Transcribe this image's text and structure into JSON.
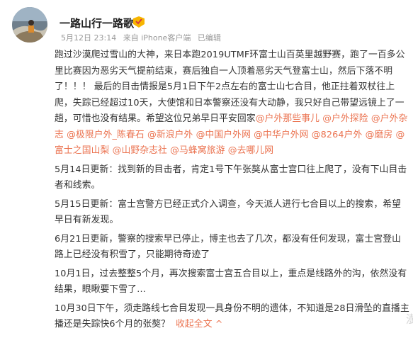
{
  "user": {
    "name": "一路山行一路歌",
    "meta": {
      "date": "5月12日 23:14",
      "source": "来自 iPhone客户端",
      "edited": "已编辑"
    }
  },
  "post": {
    "intro": "跑过沙漠爬过雪山的大神，来日本跑2019UTMF环富士山百英里越野赛，跑了一百多公里比赛因为恶劣天气提前结束，赛后独自一人顶着恶劣天气登富士山，然后下落不明了！！！ 最后的目击情报是5月1日下午2点左右的富士山七合目，他正拄着双杖往上爬，失踪已经超过10天，大使馆和日本警察还没有大动静，我只好自己带望远镜上了一趟，可惜也没有结果。希望这位兄弟早日平安回家",
    "mentions": [
      "@户外那些事儿",
      "@户外探险",
      "@户外杂志",
      "@极限户外_陈春石",
      "@新浪户外",
      "@中国户外网",
      "@中华户外网",
      "@8264户外",
      "@磨房",
      "@富士之国山梨",
      "@山野杂志社",
      "@马蜂窝旅游",
      "@去哪儿网"
    ],
    "updates": [
      "5月14日更新：找到新的目击者，肯定1号下午张獒从富士宫口往上爬了，没有下山目击者和线索。",
      "5月15日更新：富士宫警方已经正式介入调查，今天派人进行七合目以上的搜索，希望早日有新发现。",
      "6月21日更新，警察的搜索早已停止，博主也去了几次，都没有任何发现，富士宫登山路上已经没有积雪了，只能期待奇迹了",
      "10月1日，过去整整5个月，再次搜索富士宫五合目以上，重点是线路外的沟，依然没有结果，眼瞅要下雪了…"
    ],
    "last": "10月30日下午，须走路线七合目发现一具身份不明的遗体，不知道是28日滑坠的直播主播还是失踪快6个月的张獒？",
    "expand": "收起全文",
    "expand_arrow": "^"
  },
  "watermark": "澎",
  "colors": {
    "link": "#eb7350",
    "meta": "#999999",
    "text": "#333333"
  }
}
